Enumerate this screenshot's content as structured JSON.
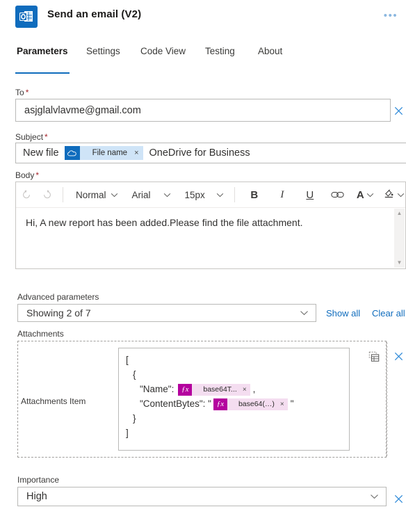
{
  "header": {
    "icon_name": "outlook-app-icon",
    "title": "Send an email (V2)",
    "more_label": "•••",
    "brand_color": "#0f6cbd"
  },
  "tabs": [
    {
      "label": "Parameters",
      "active": true
    },
    {
      "label": "Settings",
      "active": false
    },
    {
      "label": "Code View",
      "active": false
    },
    {
      "label": "Testing",
      "active": false
    },
    {
      "label": "About",
      "active": false
    }
  ],
  "fields": {
    "to": {
      "label": "To",
      "required": "*",
      "value": "asjglalvlavme@gmail.com",
      "clear_icon": "close-icon"
    },
    "subject": {
      "label": "Subject",
      "required": "*",
      "prefix_text": "New file",
      "token_icon": "onedrive-cloud-icon",
      "token_label": "File name",
      "token_remove": "×",
      "suffix_text": "OneDrive for Business"
    },
    "body": {
      "label": "Body",
      "required": "*",
      "text": "Hi, A new report has been added.Please find the file attachment.",
      "toolbar": {
        "undo": "undo-icon",
        "redo": "redo-icon",
        "style": "Normal",
        "font": "Arial",
        "size": "15px",
        "bold": "B",
        "italic": "I",
        "underline": "U",
        "link": "link-icon",
        "font_color": "A",
        "highlight": "highlight-icon"
      }
    }
  },
  "advanced": {
    "label": "Advanced parameters",
    "select_value": "Showing 2 of 7",
    "show_all": "Show all",
    "clear_all": "Clear all"
  },
  "attachments": {
    "group_label": "Attachments",
    "item_label": "Attachments Item",
    "table_view_icon": "table-view-icon",
    "clear_icon": "close-icon",
    "json_lines": {
      "l1": "[",
      "l2": "{",
      "l3_key": "\"Name\":",
      "l3_token_fx": "ƒx",
      "l3_token_label": "base64T...",
      "l3_token_remove": "×",
      "l3_tail": ",",
      "l4_key": "\"ContentBytes\": \"",
      "l4_token_fx": "ƒx",
      "l4_token_label": "base64(…)",
      "l4_token_remove": "×",
      "l4_tail": "\"",
      "l5": "}",
      "l6": "]"
    }
  },
  "importance": {
    "label": "Importance",
    "value": "High",
    "clear_icon": "close-icon",
    "chevron_icon": "chevron-down-icon"
  }
}
